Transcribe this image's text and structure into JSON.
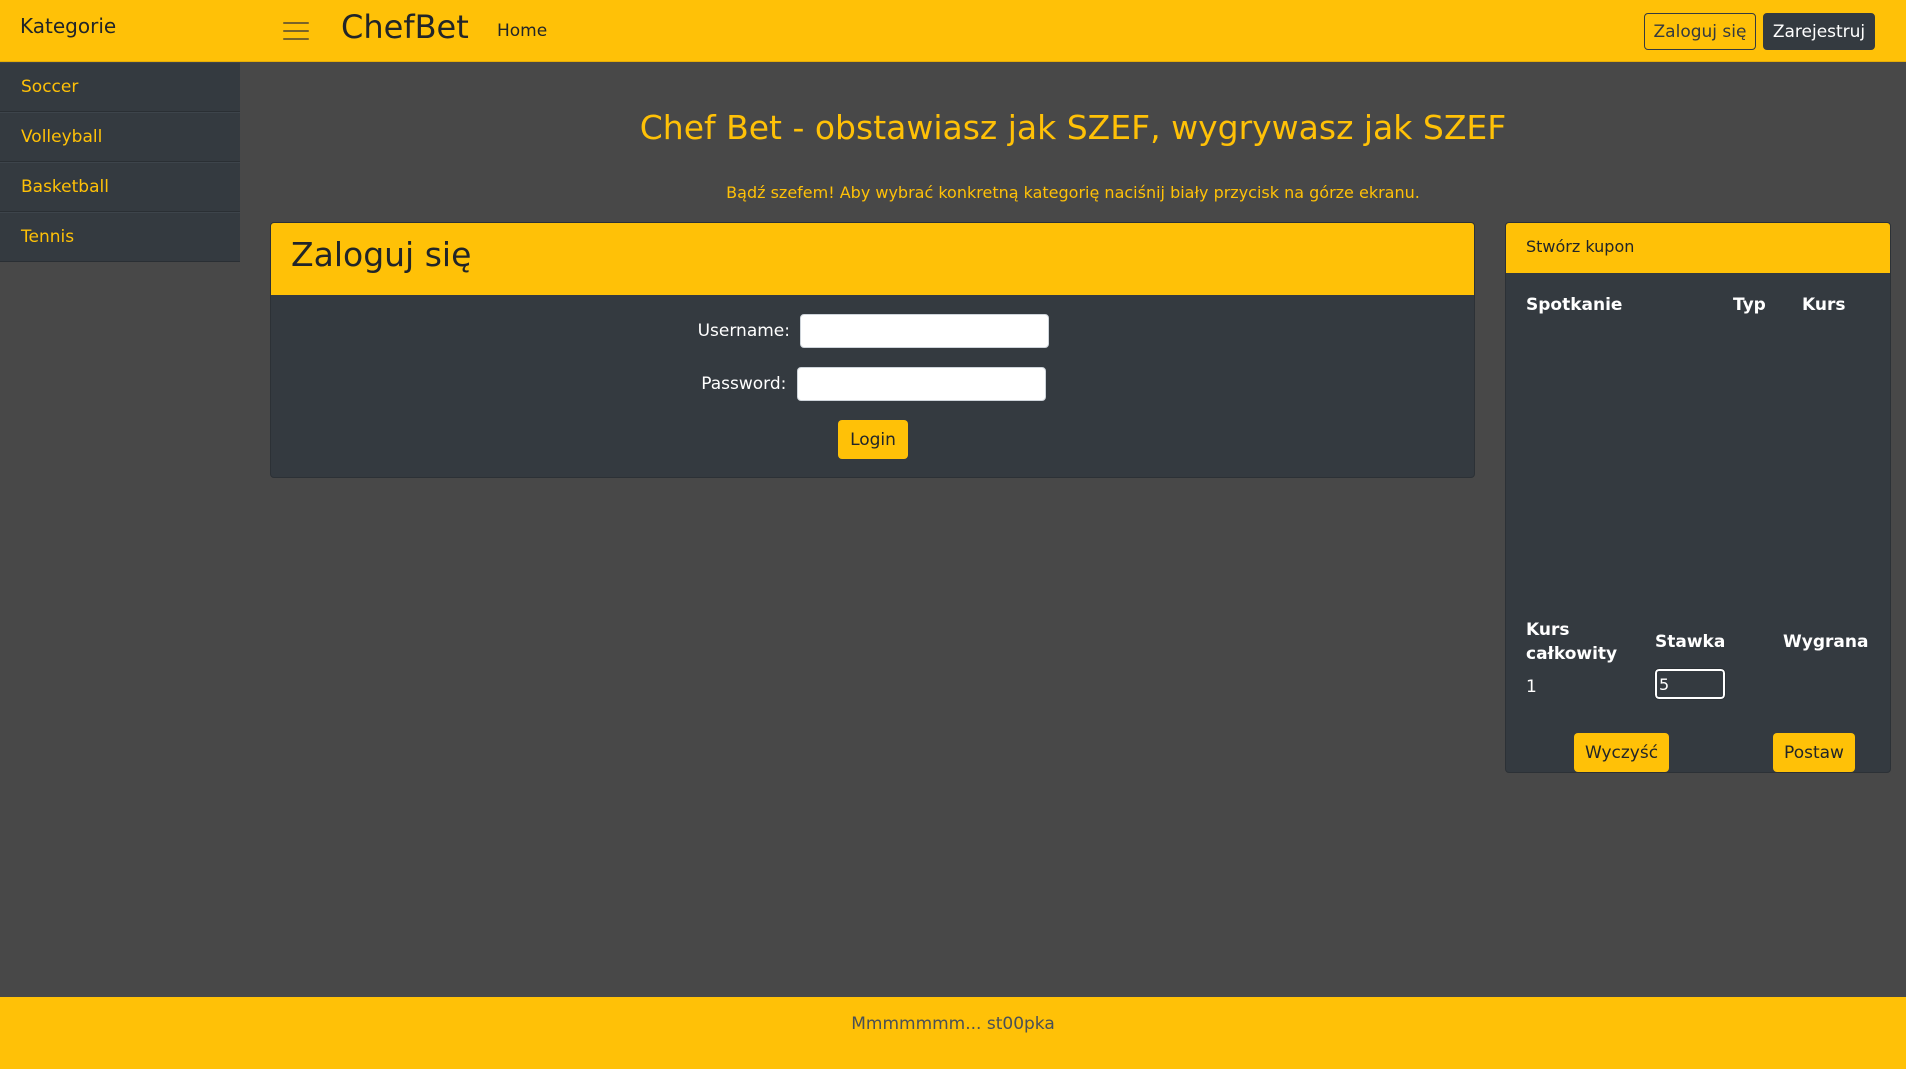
{
  "header": {
    "sidebar_title": "Kategorie",
    "brand": "ChefBet",
    "nav_home": "Home",
    "login_button": "Zaloguj się",
    "register_button": "Zarejestruj"
  },
  "sidebar": {
    "items": [
      {
        "label": "Soccer"
      },
      {
        "label": "Volleyball"
      },
      {
        "label": "Basketball"
      },
      {
        "label": "Tennis"
      }
    ]
  },
  "main": {
    "title": "Chef Bet - obstawiasz jak SZEF, wygrywasz jak SZEF",
    "subtitle": "Bądź szefem! Aby wybrać konkretną kategorię naciśnij biały przycisk na górze ekranu."
  },
  "login": {
    "title": "Zaloguj się",
    "username_label": "Username:",
    "password_label": "Password:",
    "username_value": "",
    "password_value": "",
    "submit_label": "Login"
  },
  "coupon": {
    "title": "Stwórz kupon",
    "columns": [
      "Spotkanie",
      "Typ",
      "Kurs"
    ],
    "summary_columns": {
      "total_odds_line1": "Kurs",
      "total_odds_line2": "całkowity",
      "stake": "Stawka",
      "win": "Wygrana"
    },
    "total_odds_value": "1",
    "stake_value": "5",
    "clear_button": "Wyczyść",
    "place_button": "Postaw"
  },
  "footer": {
    "text": "Mmmmmmm... st00pka"
  },
  "colors": {
    "accent": "#ffc107",
    "dark": "#343a40",
    "background": "#484848"
  }
}
